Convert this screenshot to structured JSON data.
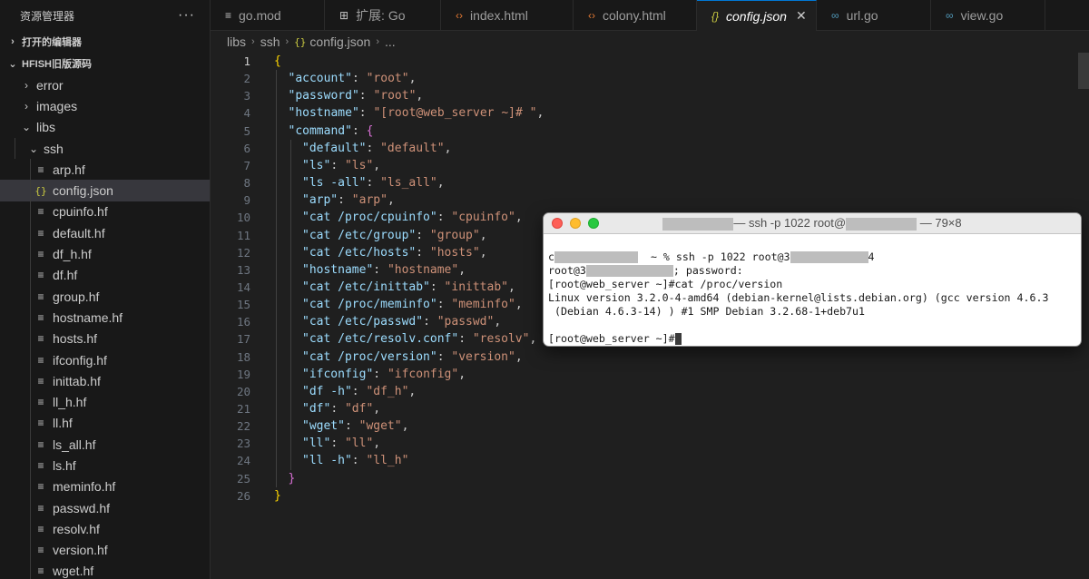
{
  "sidebar": {
    "title": "资源管理器",
    "more": "···",
    "open_editors": "打开的编辑器",
    "project": "HFISH旧版源码",
    "folders": {
      "error": "error",
      "images": "images",
      "libs": "libs",
      "ssh": "ssh"
    },
    "files": [
      "arp.hf",
      "config.json",
      "cpuinfo.hf",
      "default.hf",
      "df_h.hf",
      "df.hf",
      "group.hf",
      "hostname.hf",
      "hosts.hf",
      "ifconfig.hf",
      "inittab.hf",
      "ll_h.hf",
      "ll.hf",
      "ls_all.hf",
      "ls.hf",
      "meminfo.hf",
      "passwd.hf",
      "resolv.hf",
      "version.hf",
      "wget.hf"
    ],
    "selected_file": "config.json"
  },
  "tabs": [
    {
      "label": "go.mod",
      "icon": "go-mod-icon"
    },
    {
      "label": "扩展: Go",
      "icon": "extensions-icon"
    },
    {
      "label": "index.html",
      "icon": "html-icon"
    },
    {
      "label": "colony.html",
      "icon": "html-icon"
    },
    {
      "label": "config.json",
      "icon": "json-icon",
      "active": true
    },
    {
      "label": "url.go",
      "icon": "go-icon"
    },
    {
      "label": "view.go",
      "icon": "go-icon"
    }
  ],
  "breadcrumb": {
    "parts": [
      "libs",
      "ssh",
      "config.json",
      "..."
    ]
  },
  "editor": {
    "current_line": 1,
    "lines": [
      {
        "n": "1",
        "t": [
          [
            "b1",
            "{"
          ]
        ],
        "i": 0
      },
      {
        "n": "2",
        "t": [
          [
            "k",
            "\"account\""
          ],
          [
            "p",
            ": "
          ],
          [
            "s",
            "\"root\""
          ],
          [
            "p",
            ","
          ]
        ],
        "i": 1
      },
      {
        "n": "3",
        "t": [
          [
            "k",
            "\"password\""
          ],
          [
            "p",
            ": "
          ],
          [
            "s",
            "\"root\""
          ],
          [
            "p",
            ","
          ]
        ],
        "i": 1
      },
      {
        "n": "4",
        "t": [
          [
            "k",
            "\"hostname\""
          ],
          [
            "p",
            ": "
          ],
          [
            "s",
            "\"[root@web_server ~]# \""
          ],
          [
            "p",
            ","
          ]
        ],
        "i": 1
      },
      {
        "n": "5",
        "t": [
          [
            "k",
            "\"command\""
          ],
          [
            "p",
            ": "
          ],
          [
            "b2",
            "{"
          ]
        ],
        "i": 1
      },
      {
        "n": "6",
        "t": [
          [
            "k",
            "\"default\""
          ],
          [
            "p",
            ": "
          ],
          [
            "s",
            "\"default\""
          ],
          [
            "p",
            ","
          ]
        ],
        "i": 2
      },
      {
        "n": "7",
        "t": [
          [
            "k",
            "\"ls\""
          ],
          [
            "p",
            ": "
          ],
          [
            "s",
            "\"ls\""
          ],
          [
            "p",
            ","
          ]
        ],
        "i": 2
      },
      {
        "n": "8",
        "t": [
          [
            "k",
            "\"ls -all\""
          ],
          [
            "p",
            ": "
          ],
          [
            "s",
            "\"ls_all\""
          ],
          [
            "p",
            ","
          ]
        ],
        "i": 2
      },
      {
        "n": "9",
        "t": [
          [
            "k",
            "\"arp\""
          ],
          [
            "p",
            ": "
          ],
          [
            "s",
            "\"arp\""
          ],
          [
            "p",
            ","
          ]
        ],
        "i": 2
      },
      {
        "n": "10",
        "t": [
          [
            "k",
            "\"cat /proc/cpuinfo\""
          ],
          [
            "p",
            ": "
          ],
          [
            "s",
            "\"cpuinfo\""
          ],
          [
            "p",
            ","
          ]
        ],
        "i": 2
      },
      {
        "n": "11",
        "t": [
          [
            "k",
            "\"cat /etc/group\""
          ],
          [
            "p",
            ": "
          ],
          [
            "s",
            "\"group\""
          ],
          [
            "p",
            ","
          ]
        ],
        "i": 2
      },
      {
        "n": "12",
        "t": [
          [
            "k",
            "\"cat /etc/hosts\""
          ],
          [
            "p",
            ": "
          ],
          [
            "s",
            "\"hosts\""
          ],
          [
            "p",
            ","
          ]
        ],
        "i": 2
      },
      {
        "n": "13",
        "t": [
          [
            "k",
            "\"hostname\""
          ],
          [
            "p",
            ": "
          ],
          [
            "s",
            "\"hostname\""
          ],
          [
            "p",
            ","
          ]
        ],
        "i": 2
      },
      {
        "n": "14",
        "t": [
          [
            "k",
            "\"cat /etc/inittab\""
          ],
          [
            "p",
            ": "
          ],
          [
            "s",
            "\"inittab\""
          ],
          [
            "p",
            ","
          ]
        ],
        "i": 2
      },
      {
        "n": "15",
        "t": [
          [
            "k",
            "\"cat /proc/meminfo\""
          ],
          [
            "p",
            ": "
          ],
          [
            "s",
            "\"meminfo\""
          ],
          [
            "p",
            ","
          ]
        ],
        "i": 2
      },
      {
        "n": "16",
        "t": [
          [
            "k",
            "\"cat /etc/passwd\""
          ],
          [
            "p",
            ": "
          ],
          [
            "s",
            "\"passwd\""
          ],
          [
            "p",
            ","
          ]
        ],
        "i": 2
      },
      {
        "n": "17",
        "t": [
          [
            "k",
            "\"cat /etc/resolv.conf\""
          ],
          [
            "p",
            ": "
          ],
          [
            "s",
            "\"resolv\""
          ],
          [
            "p",
            ","
          ]
        ],
        "i": 2
      },
      {
        "n": "18",
        "t": [
          [
            "k",
            "\"cat /proc/version\""
          ],
          [
            "p",
            ": "
          ],
          [
            "s",
            "\"version\""
          ],
          [
            "p",
            ","
          ]
        ],
        "i": 2
      },
      {
        "n": "19",
        "t": [
          [
            "k",
            "\"ifconfig\""
          ],
          [
            "p",
            ": "
          ],
          [
            "s",
            "\"ifconfig\""
          ],
          [
            "p",
            ","
          ]
        ],
        "i": 2
      },
      {
        "n": "20",
        "t": [
          [
            "k",
            "\"df -h\""
          ],
          [
            "p",
            ": "
          ],
          [
            "s",
            "\"df_h\""
          ],
          [
            "p",
            ","
          ]
        ],
        "i": 2
      },
      {
        "n": "21",
        "t": [
          [
            "k",
            "\"df\""
          ],
          [
            "p",
            ": "
          ],
          [
            "s",
            "\"df\""
          ],
          [
            "p",
            ","
          ]
        ],
        "i": 2
      },
      {
        "n": "22",
        "t": [
          [
            "k",
            "\"wget\""
          ],
          [
            "p",
            ": "
          ],
          [
            "s",
            "\"wget\""
          ],
          [
            "p",
            ","
          ]
        ],
        "i": 2
      },
      {
        "n": "23",
        "t": [
          [
            "k",
            "\"ll\""
          ],
          [
            "p",
            ": "
          ],
          [
            "s",
            "\"ll\""
          ],
          [
            "p",
            ","
          ]
        ],
        "i": 2
      },
      {
        "n": "24",
        "t": [
          [
            "k",
            "\"ll -h\""
          ],
          [
            "p",
            ": "
          ],
          [
            "s",
            "\"ll_h\""
          ]
        ],
        "i": 2
      },
      {
        "n": "25",
        "t": [
          [
            "b2",
            "}"
          ]
        ],
        "i": 1
      },
      {
        "n": "26",
        "t": [
          [
            "b1",
            "}"
          ]
        ],
        "i": 0
      }
    ]
  },
  "terminal": {
    "title_mid": "— ssh -p 1022 root@",
    "title_end": "— 79×8",
    "lines": [
      {
        "pre": "",
        "redact": 0,
        "post": ""
      },
      {
        "pre": "c",
        "redact": 1,
        "post": "  ~ % ssh -p 1022 root@3",
        "redact2": 1,
        "post2": "4"
      },
      {
        "pre": "root@3",
        "redact": 1,
        "post": "; password:"
      },
      {
        "pre": "[root@web_server ~]#cat /proc/version",
        "redact": 0,
        "post": ""
      },
      {
        "pre": "Linux version 3.2.0-4-amd64 (debian-kernel@lists.debian.org) (gcc version 4.6.3",
        "redact": 0,
        "post": ""
      },
      {
        "pre": " (Debian 4.6.3-14) ) #1 SMP Debian 3.2.68-1+deb7u1",
        "redact": 0,
        "post": ""
      },
      {
        "pre": "",
        "redact": 0,
        "post": ""
      },
      {
        "pre": "[root@web_server ~]#",
        "redact": 0,
        "post": "",
        "cursor": true
      }
    ]
  }
}
